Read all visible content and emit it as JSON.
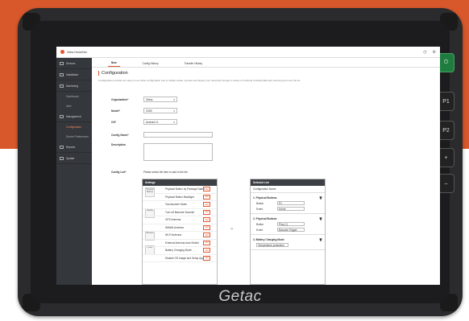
{
  "app": {
    "title": "Getac DeviceHub",
    "brand": "Getac"
  },
  "side_buttons": [
    "P1",
    "P2",
    "+",
    "–"
  ],
  "sidebar": {
    "items": [
      {
        "label": "Devices"
      },
      {
        "label": "Installation"
      },
      {
        "label": "Monitoring"
      },
      {
        "label": "Dashboard",
        "sub": true
      },
      {
        "label": "Alert",
        "sub": true
      },
      {
        "label": "Management"
      },
      {
        "label": "Configuration",
        "sub": true,
        "active": true
      },
      {
        "label": "Device Preferences",
        "sub": true
      },
      {
        "label": "Reports"
      },
      {
        "label": "Update"
      }
    ]
  },
  "tabs": [
    "New",
    "Config History",
    "Transfer History"
  ],
  "page": {
    "title": "Configuration",
    "description": "Configuration provides an easy to use online configuration tool to rapidly create, preview and deploy your device(s) through a variety of methods including Barcode scanning and over the air."
  },
  "form": {
    "organization_label": "Organization*",
    "organization_value": "Getac",
    "model_label": "Model*",
    "model_value": "ZX80",
    "os_label": "OS*",
    "os_value": "Android 12",
    "config_name_label": "Config Name*",
    "description_label": "Description",
    "config_list_label": "Config List*",
    "config_list_hint": "Please select the item to add to the list"
  },
  "settings_panel": {
    "title": "Settings",
    "add_label": "Add",
    "categories": [
      "Physical Buttons",
      "Display",
      "Wireless",
      "Power"
    ],
    "items": [
      "Physical Button by Package Name",
      "Physical Button Backlight",
      "Touchscreen Mode",
      "Turn off Barcode Scanner",
      "GPS Antenna",
      "WWAN Antenna",
      "Wi-Fi Antenna",
      "External Antenna Auto Switch",
      "Battery Charging Mode",
      "Disable OS Image and Setup App"
    ]
  },
  "selected_panel": {
    "title": "Selected List",
    "config_name_placeholder": "Configuration Name",
    "groups": [
      {
        "num": "1.",
        "title": "Physical Buttons",
        "rows": [
          {
            "k": "Button",
            "v": "P1"
          },
          {
            "k": "Event",
            "v": "Home"
          }
        ]
      },
      {
        "num": "2.",
        "title": "Physical Buttons",
        "rows": [
          {
            "k": "Button",
            "v": "Plus (+)"
          },
          {
            "k": "Event",
            "v": "Barcode Trigger"
          }
        ]
      },
      {
        "num": "3.",
        "title": "Battery Charging Mode",
        "rows": [
          {
            "k": "",
            "v": "Temperature protection"
          }
        ]
      }
    ]
  }
}
